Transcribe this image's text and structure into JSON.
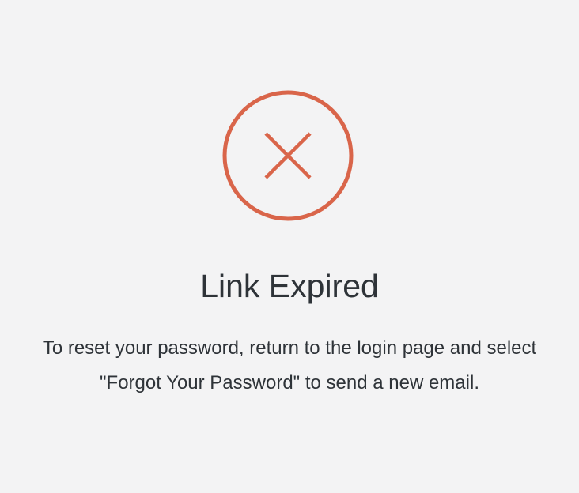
{
  "status": {
    "icon": "error-x-circle-icon",
    "color": "#d9654a",
    "title": "Link Expired",
    "message": "To reset your password, return to the login page and select \"Forgot Your Password\" to send a new email."
  }
}
